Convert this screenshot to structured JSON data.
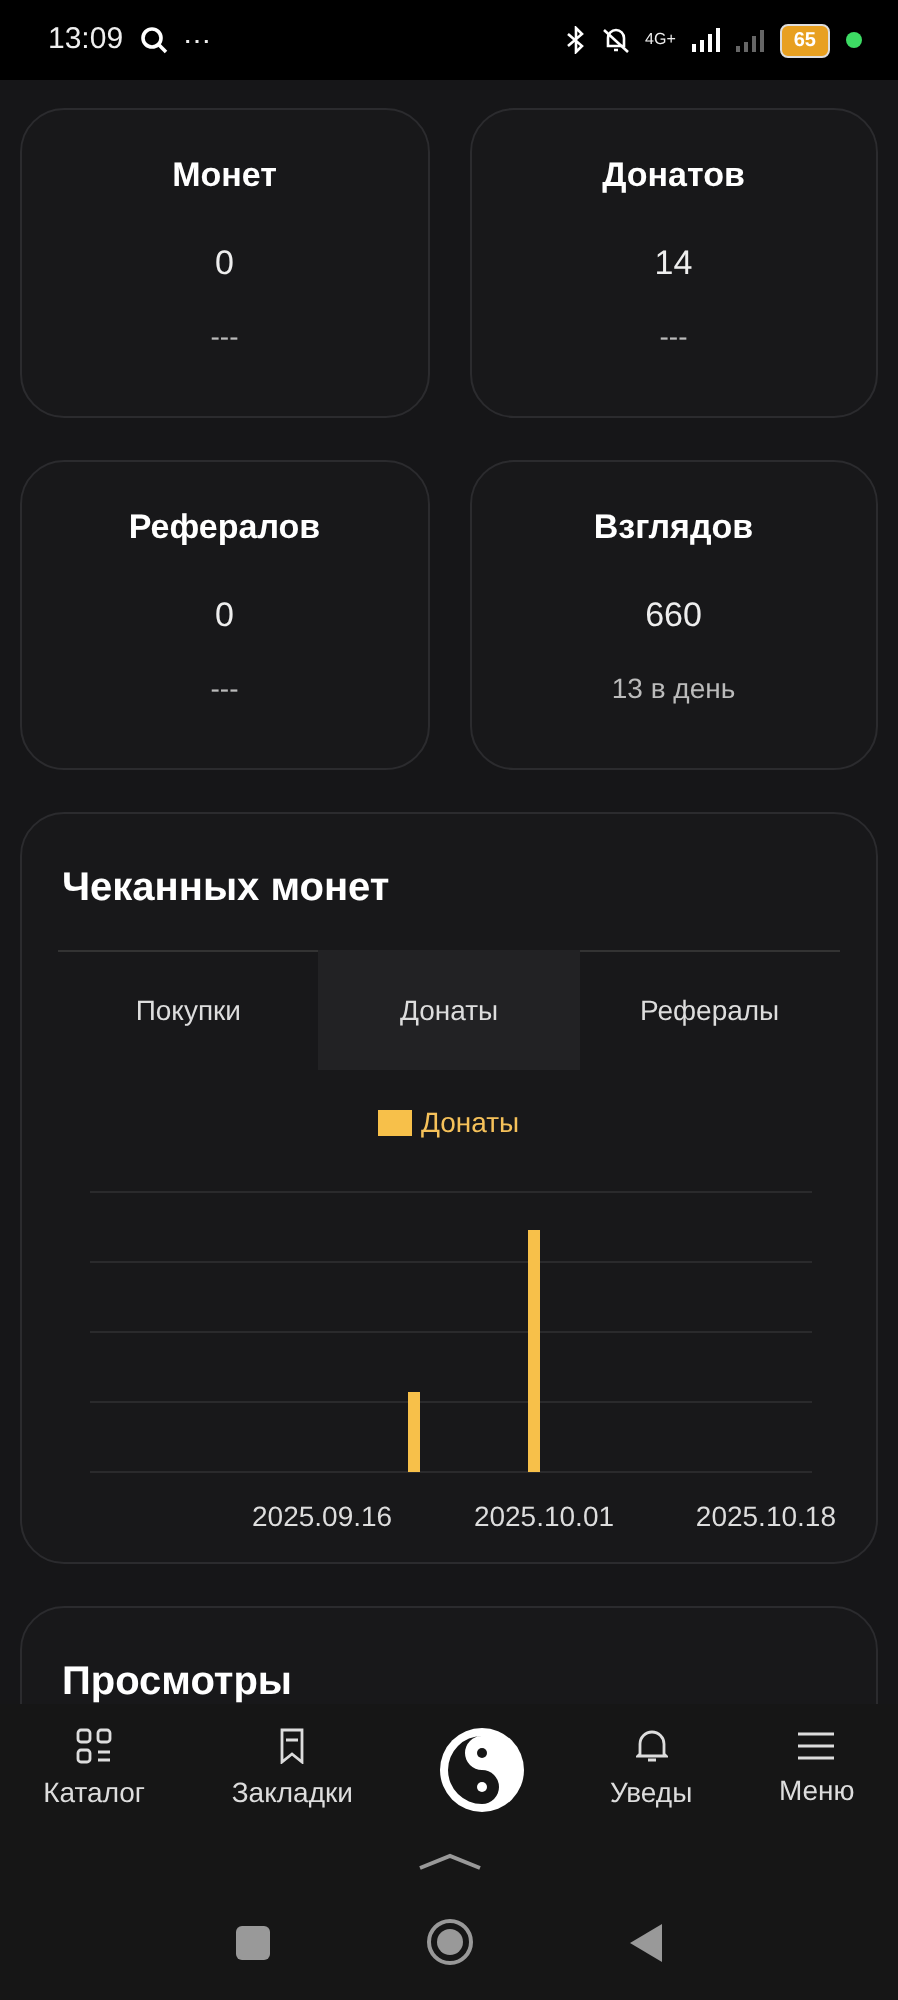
{
  "status_bar": {
    "time": "13:09",
    "more": "⋯",
    "network": "4G+",
    "battery": "65"
  },
  "stats": [
    {
      "title": "Монет",
      "value": "0",
      "note": "---"
    },
    {
      "title": "Донатов",
      "value": "14",
      "note": "---"
    },
    {
      "title": "Рефералов",
      "value": "0",
      "note": "---"
    },
    {
      "title": "Взглядов",
      "value": "660",
      "note": "13 в день"
    }
  ],
  "minted_card": {
    "title": "Чеканных монет",
    "tabs": [
      {
        "label": "Покупки",
        "selected": false
      },
      {
        "label": "Донаты",
        "selected": true
      },
      {
        "label": "Рефералы",
        "selected": false
      }
    ],
    "legend": "Донаты",
    "x_labels": [
      "2025.09.16",
      "2025.10.01",
      "2025.10.18"
    ]
  },
  "views_card": {
    "title": "Просмотры"
  },
  "bottom_nav": [
    {
      "kind": "catalog",
      "label": "Каталог"
    },
    {
      "kind": "bookmarks",
      "label": "Закладки"
    },
    {
      "kind": "logo"
    },
    {
      "kind": "notifications",
      "label": "Уведы"
    },
    {
      "kind": "menu",
      "label": "Меню"
    }
  ]
}
